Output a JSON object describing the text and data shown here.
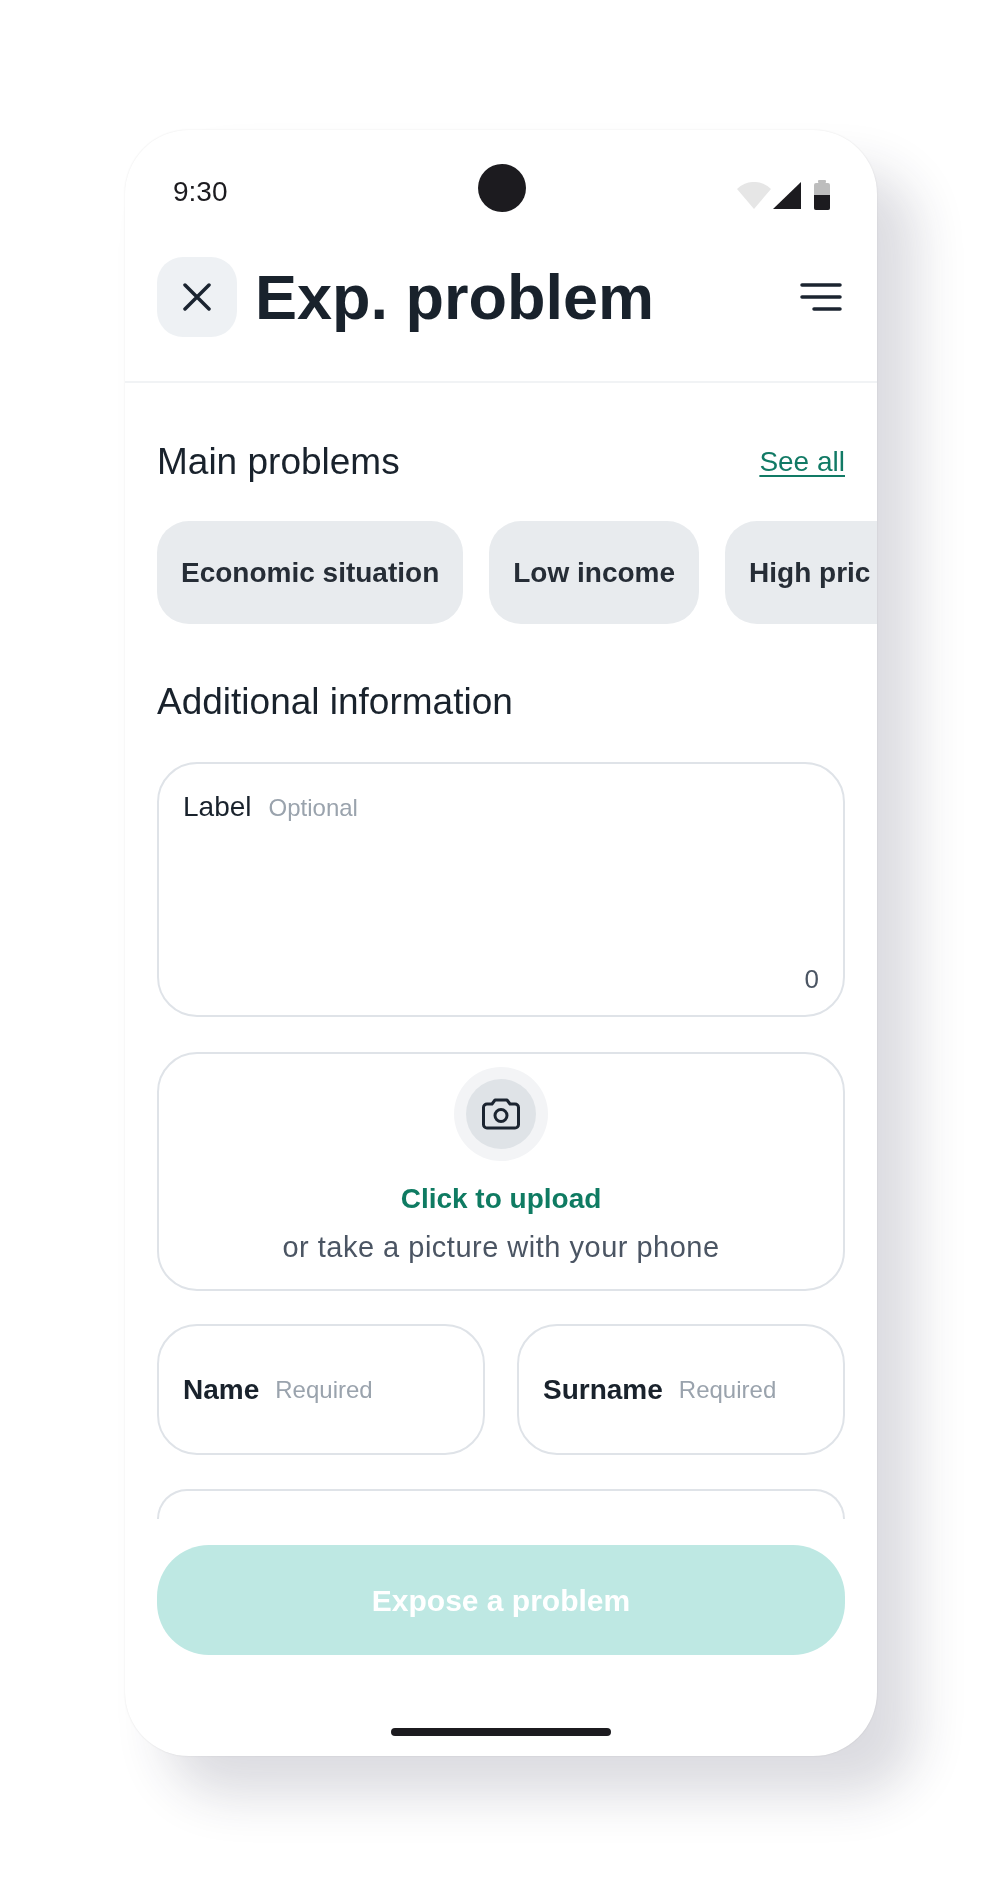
{
  "status_bar": {
    "time": "9:30"
  },
  "header": {
    "title": "Exp. problem"
  },
  "main_problems": {
    "title": "Main problems",
    "see_all": "See all",
    "chips": [
      {
        "label": "Economic situation",
        "selected": false
      },
      {
        "label": "Low income",
        "selected": false
      },
      {
        "label": "High pric",
        "selected": false
      }
    ]
  },
  "additional_information": {
    "title": "Additional information",
    "description": {
      "label": "Label",
      "hint": "Optional",
      "count": "0"
    },
    "upload": {
      "action": "Click to upload",
      "hint": "or take a picture with your phone"
    },
    "name_fields": [
      {
        "label": "Name",
        "hint": "Required"
      },
      {
        "label": "Surname",
        "hint": "Required"
      }
    ]
  },
  "submit_button": {
    "label": "Expose a problem",
    "disabled": true
  }
}
